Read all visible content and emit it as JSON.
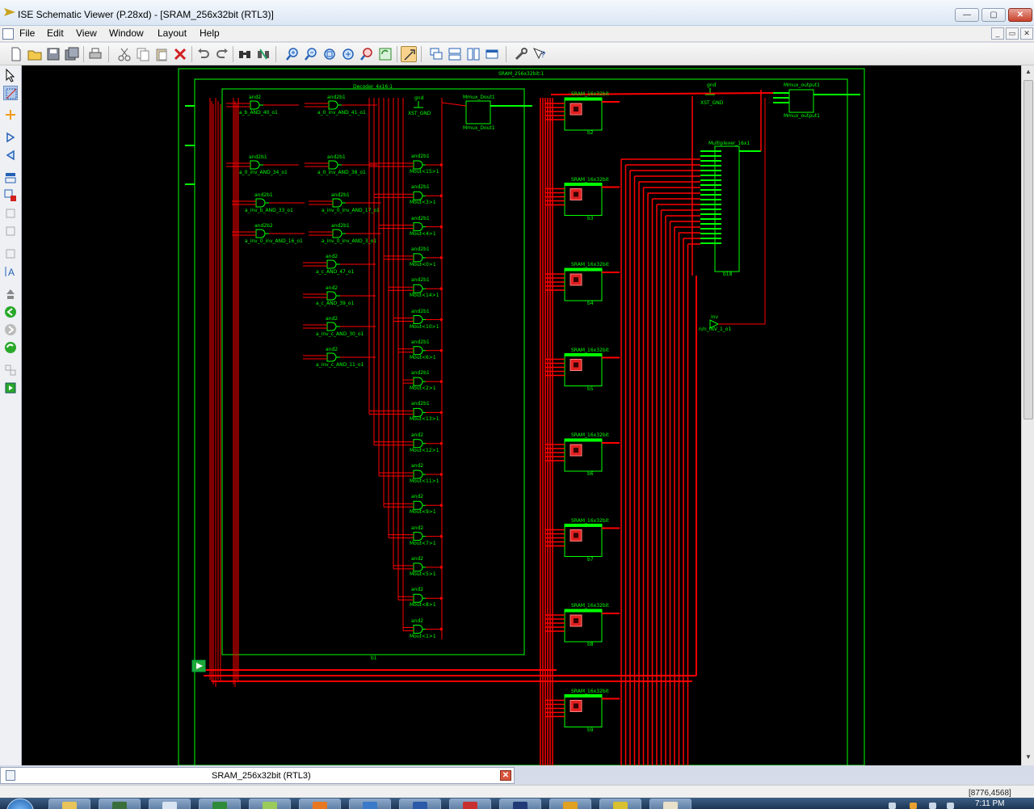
{
  "window": {
    "title": "ISE Schematic Viewer (P.28xd) - [SRAM_256x32bit (RTL3)]",
    "controls": {
      "minimize": "—",
      "maximize": "▢",
      "close": "✕"
    },
    "mdi_controls": {
      "minimize": "_",
      "restore": "▭",
      "close": "✕"
    }
  },
  "menu": {
    "items": [
      "File",
      "Edit",
      "View",
      "Window",
      "Layout",
      "Help"
    ]
  },
  "toolbar": {
    "icons": [
      "new-icon",
      "open-icon",
      "save-icon",
      "save-all-icon",
      "print-icon",
      "cut-icon",
      "copy-icon",
      "paste-icon",
      "delete-icon",
      "undo-icon",
      "redo-icon",
      "find-icon",
      "find-replace-icon",
      "zoom-in-icon",
      "zoom-out-icon",
      "zoom-full-icon",
      "zoom-fit-icon",
      "zoom-selected-icon",
      "refresh-icon",
      "pan-icon",
      "cascade-icon",
      "tile-horizontal-icon",
      "tile-vertical-icon",
      "arrange-icon",
      "properties-icon",
      "context-help-icon"
    ]
  },
  "left_tools": {
    "icons": [
      "select-icon",
      "zoom-area-icon",
      "add-wire-icon",
      "forward-icon",
      "back-icon",
      "hierarchy-icon",
      "mark-icon",
      "blank-icon",
      "blank2-icon",
      "blank3-icon",
      "text-icon",
      "push-icon",
      "go-back-icon",
      "go-forward-icon",
      "refresh-view-icon",
      "toggle-icon",
      "run-icon"
    ]
  },
  "schematic": {
    "top_label": "SRAM_256x32bit:1",
    "decoder": {
      "name": "Decoder_4x16:1",
      "instance": "b1",
      "and_gates_left": [
        {
          "type": "and2",
          "name": "a_b_AND_40_o1"
        },
        {
          "type": "and2b1",
          "name": "a_0_inv_AND_41_o1"
        },
        {
          "type": "and2b1",
          "name": "a_0_inv_AND_34_o1"
        },
        {
          "type": "and2b1",
          "name": "a_0_inv_AND_38_o1"
        },
        {
          "type": "and2b1",
          "name": "a_inv_b_AND_33_o1"
        },
        {
          "type": "and2b1",
          "name": "a_inv_0_inv_AND_17_o1"
        },
        {
          "type": "and2b2",
          "name": "a_inv_0_inv_AND_16_o1"
        },
        {
          "type": "and2b1",
          "name": "a_inv_0_inv_AND_3_o1"
        },
        {
          "type": "and2",
          "name": "a_c_AND_47_o1"
        },
        {
          "type": "and2",
          "name": "a_c_AND_39_o1"
        },
        {
          "type": "and2",
          "name": "a_inv_c_AND_30_o1"
        },
        {
          "type": "and2",
          "name": "a_inv_c_AND_11_o1"
        }
      ],
      "outputs": [
        "Mout<15>1",
        "Mout<3>1",
        "Mout<4>1",
        "Mout<0>1",
        "Mout<14>1",
        "Mout<10>1",
        "Mout<6>1",
        "Mout<2>1",
        "Mout<13>1",
        "Mout<12>1",
        "Mout<11>1",
        "Mout<9>1",
        "Mout<7>1",
        "Mout<5>1",
        "Mout<8>1",
        "Mout<1>1"
      ],
      "output_types": [
        "and2b1",
        "and2b1",
        "and2b1",
        "and2b1",
        "and2b1",
        "and2b1",
        "and2b1",
        "and2b1",
        "and2b1",
        "and2",
        "and2",
        "and2",
        "and2",
        "and2",
        "and2",
        "and2"
      ],
      "gnd_label": "gnd",
      "gnd_name": "XST_GND",
      "mux_name": "Mmux_Dout1"
    },
    "sram_blocks": [
      {
        "label": "SRAM_16x32bit",
        "instance": "b2"
      },
      {
        "label": "SRAM_16x32bit",
        "instance": "b3"
      },
      {
        "label": "SRAM_16x32bit",
        "instance": "b4"
      },
      {
        "label": "SRAM_16x32bit",
        "instance": "b5"
      },
      {
        "label": "SRAM_16x32bit",
        "instance": "b6"
      },
      {
        "label": "SRAM_16x32bit",
        "instance": "b7"
      },
      {
        "label": "SRAM_16x32bit",
        "instance": "b8"
      },
      {
        "label": "SRAM_16x32bit",
        "instance": "b9"
      },
      {
        "label": "SRAM_16x32bit",
        "instance": ""
      }
    ],
    "multiplexer": {
      "label": "Multiplexer_16x1",
      "instance": "b18"
    },
    "output_mux": {
      "label": "Mmux_output1",
      "sublabel": "Mmux_output1"
    },
    "gnd2": {
      "label": "gnd",
      "name": "XST_GND"
    },
    "inverter": {
      "label": "inv",
      "name": "n/n_INV_1_o1"
    }
  },
  "tabs": {
    "document": "SRAM_256x32bit (RTL3)",
    "close": "✕"
  },
  "status": {
    "coords": "[8776,4568]"
  },
  "taskbar": {
    "clock": "7:11 PM"
  },
  "colors": {
    "canvas": "#000000",
    "block": "#00ff00",
    "wire": "#ff0000",
    "instance": "#e02020"
  }
}
